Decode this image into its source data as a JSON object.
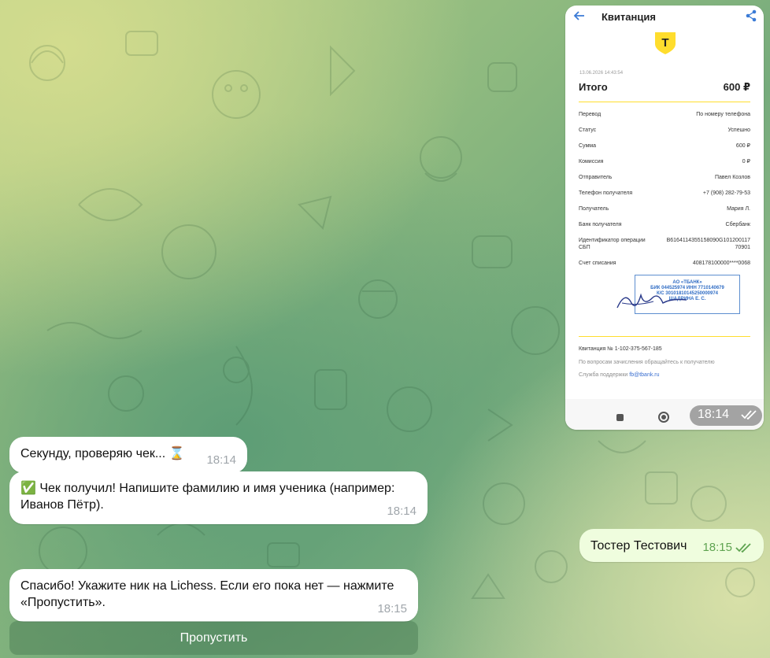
{
  "receipt": {
    "title": "Квитанция",
    "logo_letter": "T",
    "date": "13.06.2026 14:43:54",
    "total_label": "Итого",
    "total_value": "600 ₽",
    "rows": [
      {
        "k": "Перевод",
        "v": "По номеру телефона"
      },
      {
        "k": "Статус",
        "v": "Успешно"
      },
      {
        "k": "Сумма",
        "v": "600 ₽"
      },
      {
        "k": "Комиссия",
        "v": "0 ₽"
      },
      {
        "k": "Отправитель",
        "v": "Павел Козлов"
      },
      {
        "k": "Телефон получателя",
        "v": "+7 (908) 282-79-53"
      },
      {
        "k": "Получатель",
        "v": "Мария Л."
      },
      {
        "k": "Банк получателя",
        "v": "Сбербанк"
      },
      {
        "k": "Идентификатор операции СБП",
        "v": "B6164114355158090G101200117 70901"
      },
      {
        "k": "Счет списания",
        "v": "408178100000****0068"
      }
    ],
    "stamp": [
      "АО «ТБАНК»",
      "БИК 044525974 ИНН 7710140679",
      "К/С 30101810145250000974",
      "ШАДРИНА Е. С."
    ],
    "receipt_number": "Квитанция № 1-102-375-567-185",
    "note": "По вопросам зачисления обращайтесь к получателю",
    "support_label": "Служба поддержки",
    "support_email": "fb@tbank.ru",
    "time": "18:14"
  },
  "messages": [
    {
      "text": "Секунду, проверяю чек... ⌛",
      "time": "18:14"
    },
    {
      "text": "✅ Чек получил! Напишите фамилию и имя ученика (например: Иванов Пётр).",
      "time": "18:14"
    },
    {
      "text": "Тостер Тестович",
      "time": "18:15"
    },
    {
      "text": "Спасибо! Укажите ник на Lichess. Если его пока нет — нажмите «Пропустить».",
      "time": "18:15"
    }
  ],
  "buttons": {
    "skip": "Пропустить"
  },
  "colors": {
    "incoming": "#ffffff",
    "outgoing": "#effdde",
    "accent_green": "#5fa451",
    "tbank_yellow": "#ffdd2d"
  }
}
